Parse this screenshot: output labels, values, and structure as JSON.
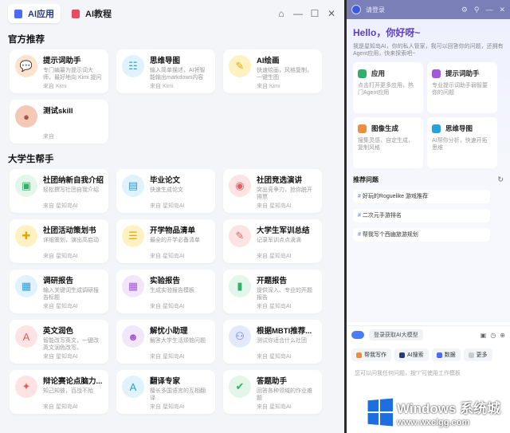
{
  "left": {
    "tabs": [
      {
        "label": "AI应用",
        "color": "#4a6cf7"
      },
      {
        "label": "AI教程",
        "color": "#e84a5f"
      }
    ],
    "window_controls": [
      "home-icon",
      "minimize-icon",
      "maximize-icon",
      "close-icon"
    ],
    "sections": [
      {
        "title": "官方推荐",
        "cards": [
          {
            "name": "提示词助手",
            "desc": "专门编纂为提示词大师，最好地向 Kimi 提问",
            "source": "来自 Kimi",
            "icon": "chat-bubble-icon",
            "bg": "#fde3cc",
            "fg": "#f08c3a"
          },
          {
            "name": "思维导图",
            "desc": "输入简单描述，AI将智能输出markdown内容",
            "source": "来自 Kimi",
            "icon": "mindmap-icon",
            "bg": "#e0f2fb",
            "fg": "#2aa0d8"
          },
          {
            "name": "AI绘画",
            "desc": "快速绘画，风格复制，一键生图",
            "source": "来自 Kimi",
            "icon": "brush-icon",
            "bg": "#fff1c2",
            "fg": "#e0a800"
          },
          {
            "name": "测试skill",
            "desc": "",
            "source": "来自",
            "icon": "avatar-photo-icon",
            "bg": "#f3c9b6",
            "fg": "#b0564a"
          }
        ]
      },
      {
        "title": "大学生帮手",
        "cards": [
          {
            "name": "社团纳新自我介绍",
            "desc": "轻松撰写社团自我介绍",
            "source": "来自 星知岛AI",
            "icon": "user-card-icon",
            "bg": "#e2f6ea",
            "fg": "#30b06a"
          },
          {
            "name": "毕业论文",
            "desc": "快速生成论文",
            "source": "来自 星知岛AI",
            "icon": "document-icon",
            "bg": "#e0f2fb",
            "fg": "#2aa0d8"
          },
          {
            "name": "社团竞选演讲",
            "desc": "突出竞争力，抢你脱开得票",
            "source": "来自 星知岛AI",
            "icon": "speech-icon",
            "bg": "#fde3e3",
            "fg": "#e06060"
          },
          {
            "name": "社团活动策划书",
            "desc": "详细策划，演出高启动",
            "source": "来自 星知岛AI",
            "icon": "plan-icon",
            "bg": "#fff1c2",
            "fg": "#e0a800"
          },
          {
            "name": "开学物品清单",
            "desc": "最全的开学必备清单",
            "source": "来自 星知岛AI",
            "icon": "checklist-icon",
            "bg": "#fff1c2",
            "fg": "#e0a800"
          },
          {
            "name": "大学生军训总结",
            "desc": "记录军训点点滴滴",
            "source": "来自 星知岛AI",
            "icon": "pen-icon",
            "bg": "#fde3e3",
            "fg": "#e06060"
          },
          {
            "name": "调研报告",
            "desc": "输入关键词生成调研报告标题",
            "source": "来自 星知岛AI",
            "icon": "report-icon",
            "bg": "#e0f2fb",
            "fg": "#2aa0d8"
          },
          {
            "name": "实验报告",
            "desc": "生成实验报告模板",
            "source": "来自 星知岛AI",
            "icon": "calendar-icon",
            "bg": "#f2e6fb",
            "fg": "#a05ad8"
          },
          {
            "name": "开题报告",
            "desc": "提供深入、专业的开题报告",
            "source": "来自 星知岛AI",
            "icon": "book-icon",
            "bg": "#e2f6ea",
            "fg": "#30b06a"
          },
          {
            "name": "英文润色",
            "desc": "智能改写英文，一键改英文润色改写。",
            "source": "来自 星知岛AI",
            "icon": "translate-icon",
            "bg": "#fde3e3",
            "fg": "#e06060"
          },
          {
            "name": "解忧小助理",
            "desc": "解答大学生活烦恼问题",
            "source": "来自 星知岛AI",
            "icon": "robot-icon",
            "bg": "#f2e6fb",
            "fg": "#a05ad8"
          },
          {
            "name": "根据MBTI推荐...",
            "desc": "测试你适合什么社团",
            "source": "来自 星知岛AI",
            "icon": "people-icon",
            "bg": "#e3e8fb",
            "fg": "#4a6cf7"
          },
          {
            "name": "辩论赛论点脑力...",
            "desc": "知己知彼，百战不殆",
            "source": "来自 星知岛AI",
            "icon": "lightbulb-icon",
            "bg": "#fde3e3",
            "fg": "#e06060"
          },
          {
            "name": "翻译专家",
            "desc": "擅长多国语言的互相翻译",
            "source": "来自 星知岛AI",
            "icon": "translate-icon",
            "bg": "#e0f2fb",
            "fg": "#2aa0d8"
          },
          {
            "name": "答题助手",
            "desc": "回答各种领域的作业难题",
            "source": "来自 星知岛AI",
            "icon": "answer-icon",
            "bg": "#e2f6ea",
            "fg": "#30b06a"
          }
        ]
      }
    ]
  },
  "right": {
    "login_text": "请登录",
    "hello": "Hello，你好呀~",
    "intro": "我是星知岛AI，你的私人管家，我可以回答你的问题，还拥有Agent应用，快来探索吧~",
    "features": [
      {
        "label": "应用",
        "desc": "点击打开更多应用，热门Agent应用",
        "color": "#30b06a"
      },
      {
        "label": "提示词助手",
        "desc": "专业提示词助手弱智要你的问题",
        "color": "#a05ad8"
      },
      {
        "label": "图像生成",
        "desc": "搜集灵感，自定生成，复制风格",
        "color": "#f08c3a"
      },
      {
        "label": "思维导图",
        "desc": "AI帮你分析，快速开拓思维",
        "color": "#2aa0d8"
      }
    ],
    "recommend_title": "推荐问题",
    "recommend": [
      "好玩的Roguelike 游戏推荐",
      "二次元手游排名",
      "帮我写个西幽旅游规划"
    ],
    "login_model": "登录获取AI大模型",
    "chips": [
      {
        "label": "帮我写作",
        "color": "#f08c3a"
      },
      {
        "label": "AI搜索",
        "color": "#2a3b7a"
      },
      {
        "label": "数据",
        "color": "#4a6cf7"
      },
      {
        "label": "更多",
        "color": "#cccccc"
      }
    ],
    "input_placeholder": "您可以问我任何问题，按\"/\"可使用工作模板"
  },
  "watermark": {
    "line1": "Windows 系统城",
    "line2": "www.wxclgg.com"
  }
}
